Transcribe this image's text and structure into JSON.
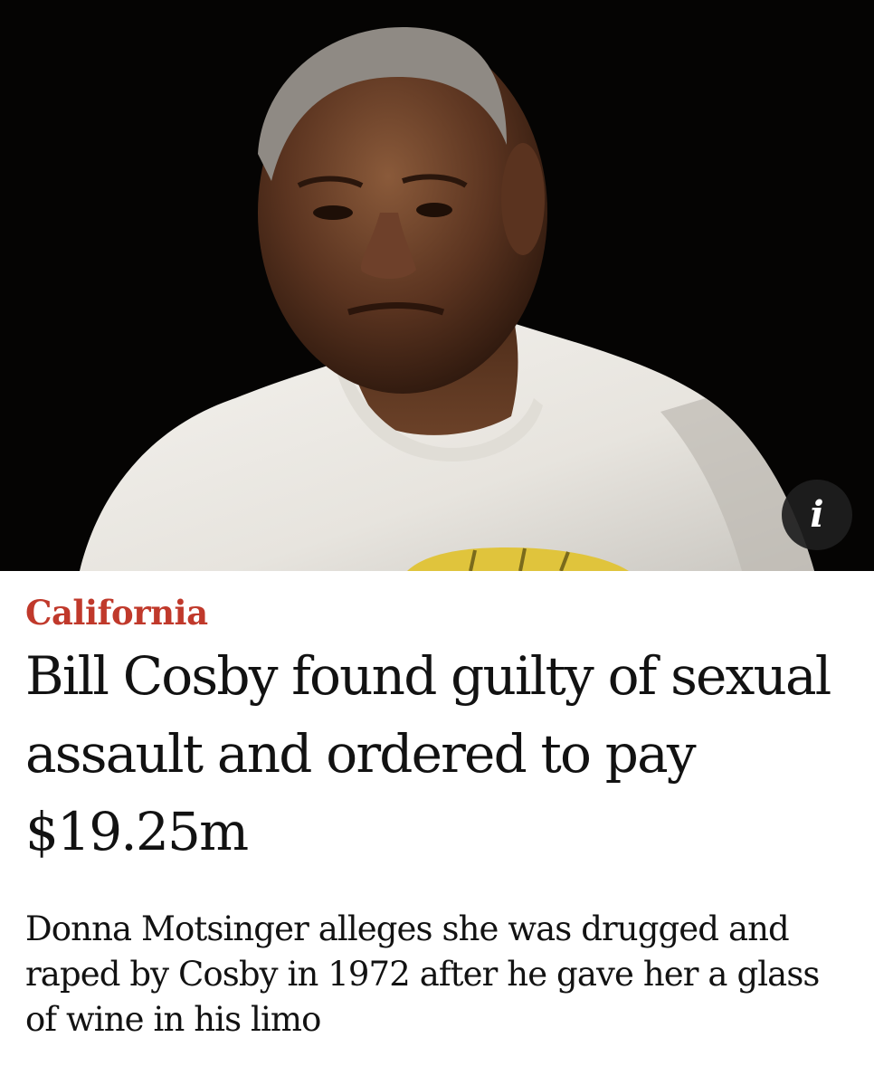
{
  "hero": {
    "image_subject": "man-in-white-tshirt-photo",
    "info_icon": "info-icon",
    "info_glyph": "i",
    "background_color": "#050403"
  },
  "article": {
    "kicker": "California",
    "kicker_color": "#c0392b",
    "headline": "Bill Cosby found guilty of sexual assault and ordered to pay $19.25m",
    "standfirst": "Donna Motsinger alleges she was drugged and raped by Cosby in 1972 after he gave her a glass of wine in his limo",
    "text_color": "#121212"
  }
}
